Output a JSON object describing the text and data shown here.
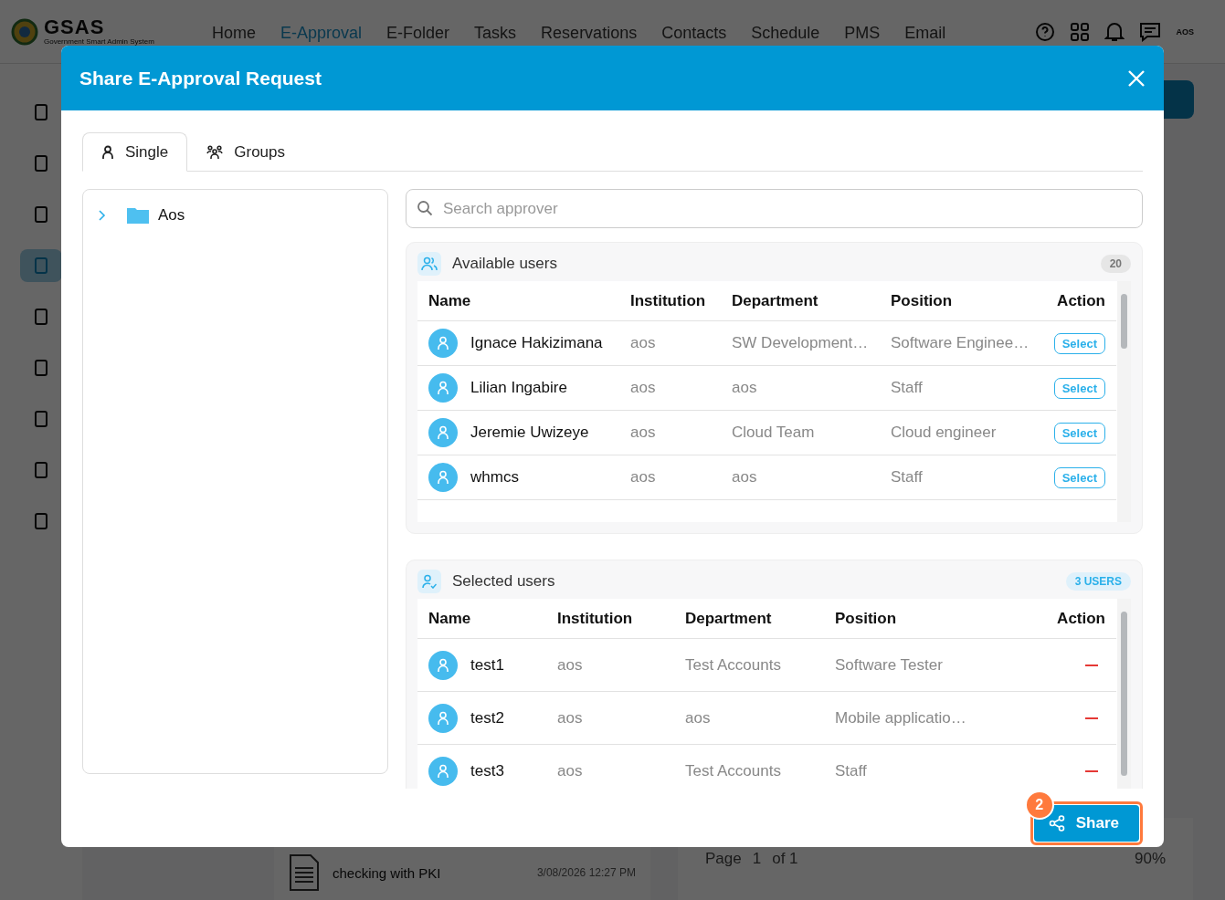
{
  "app": {
    "logo": {
      "title": "GSAS",
      "subtitle": "Government Smart Admin System"
    },
    "nav": [
      {
        "label": "Home",
        "selected": false
      },
      {
        "label": "E-Approval",
        "selected": true
      },
      {
        "label": "E-Folder",
        "selected": false
      },
      {
        "label": "Tasks",
        "selected": false
      },
      {
        "label": "Reservations",
        "selected": false
      },
      {
        "label": "Contacts",
        "selected": false
      },
      {
        "label": "Schedule",
        "selected": false
      },
      {
        "label": "PMS",
        "selected": false
      },
      {
        "label": "Email",
        "selected": false
      }
    ],
    "user_badge": "AOS",
    "sidebar": [
      {
        "selected": false
      },
      {
        "selected": false
      },
      {
        "selected": false
      },
      {
        "selected": true
      },
      {
        "selected": false
      },
      {
        "selected": false
      },
      {
        "selected": false
      },
      {
        "selected": false
      },
      {
        "selected": false
      }
    ],
    "document": {
      "title": "checking with PKI",
      "date": "3/08/2026 12:27 PM"
    },
    "pager": {
      "label": "Page",
      "page": "1",
      "of": "of 1",
      "zoom": "90%"
    }
  },
  "modal": {
    "title": "Share E-Approval Request",
    "tabs": [
      {
        "label": "Single",
        "selected": true
      },
      {
        "label": "Groups",
        "selected": false
      }
    ],
    "tree": [
      {
        "label": "Aos",
        "expanded": false
      }
    ],
    "search": {
      "placeholder": "Search approver"
    },
    "available": {
      "title": "Available users",
      "count": "20",
      "columns": [
        "Name",
        "Institution",
        "Department",
        "Position",
        "Action"
      ],
      "rows": [
        {
          "name": "Ignace Hakizimana",
          "institution": "aos",
          "department": "SW Development…",
          "position": "Software Enginee…",
          "action": "Select"
        },
        {
          "name": "Lilian Ingabire",
          "institution": "aos",
          "department": "aos",
          "position": "Staff",
          "action": "Select"
        },
        {
          "name": "Jeremie Uwizeye",
          "institution": "aos",
          "department": "Cloud Team",
          "position": "Cloud engineer",
          "action": "Select"
        },
        {
          "name": "whmcs",
          "institution": "aos",
          "department": "aos",
          "position": "Staff",
          "action": "Select"
        }
      ]
    },
    "selected": {
      "title": "Selected users",
      "count": "3 USERS",
      "columns": [
        "Name",
        "Institution",
        "Department",
        "Position",
        "Action"
      ],
      "rows": [
        {
          "name": "test1",
          "institution": "aos",
          "department": "Test Accounts",
          "position": "Software Tester"
        },
        {
          "name": "test2",
          "institution": "aos",
          "department": "aos",
          "position": "Mobile applicatio…"
        },
        {
          "name": "test3",
          "institution": "aos",
          "department": "Test Accounts",
          "position": "Staff"
        }
      ]
    },
    "share_button": {
      "label": "Share",
      "badge": "2"
    }
  }
}
